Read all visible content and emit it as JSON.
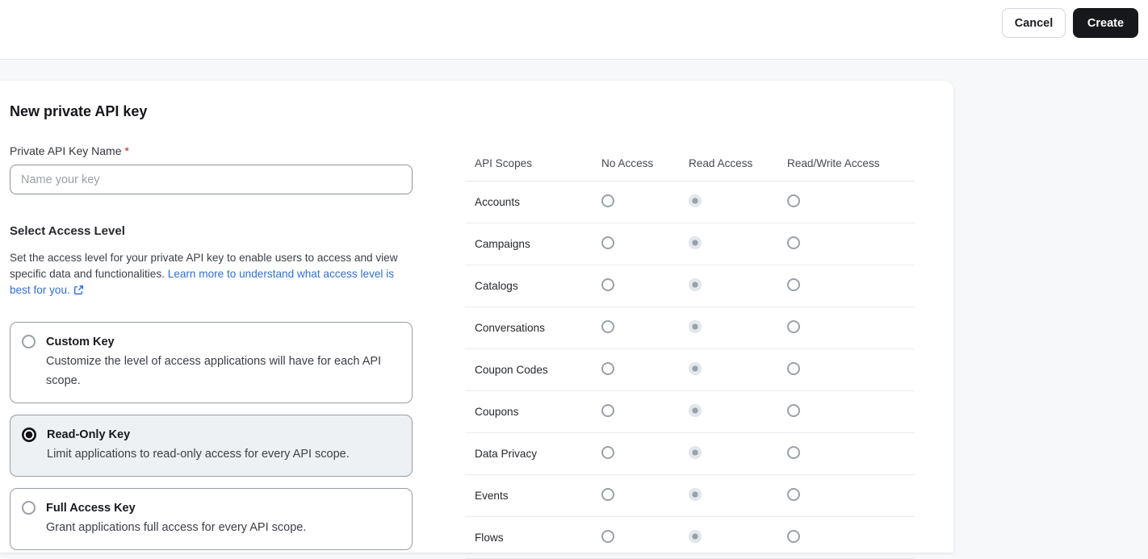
{
  "colors": {
    "page_bg": "#f7f8fa",
    "accent_dark": "#17181b",
    "link": "#2f6fd4",
    "required": "#b3261e",
    "selected_option_bg": "#eef1f3"
  },
  "topbar": {
    "cancel_label": "Cancel",
    "create_label": "Create"
  },
  "panel": {
    "title": "New private API key",
    "name_field": {
      "label": "Private API Key Name",
      "required_mark": "*",
      "value": "",
      "placeholder": "Name your key"
    },
    "access_level": {
      "heading": "Select Access Level",
      "description_before_link": "Set the access level for your private API key to enable users to access and view specific data and functionalities. ",
      "link_text": "Learn more to understand what access level is best for you.",
      "options": [
        {
          "title": "Custom Key",
          "description": "Customize the level of access applications will have for each API scope.",
          "selected": false
        },
        {
          "title": "Read-Only Key",
          "description": "Limit applications to read-only access for every API scope.",
          "selected": true
        },
        {
          "title": "Full Access Key",
          "description": "Grant applications full access for every API scope.",
          "selected": false
        }
      ]
    }
  },
  "scopes_table": {
    "columns": [
      "API Scopes",
      "No Access",
      "Read Access",
      "Read/Write Access"
    ],
    "rows": [
      {
        "label": "Accounts",
        "selected": "Read Access"
      },
      {
        "label": "Campaigns",
        "selected": "Read Access"
      },
      {
        "label": "Catalogs",
        "selected": "Read Access"
      },
      {
        "label": "Conversations",
        "selected": "Read Access"
      },
      {
        "label": "Coupon Codes",
        "selected": "Read Access"
      },
      {
        "label": "Coupons",
        "selected": "Read Access"
      },
      {
        "label": "Data Privacy",
        "selected": "Read Access"
      },
      {
        "label": "Events",
        "selected": "Read Access"
      },
      {
        "label": "Flows",
        "selected": "Read Access"
      }
    ]
  }
}
